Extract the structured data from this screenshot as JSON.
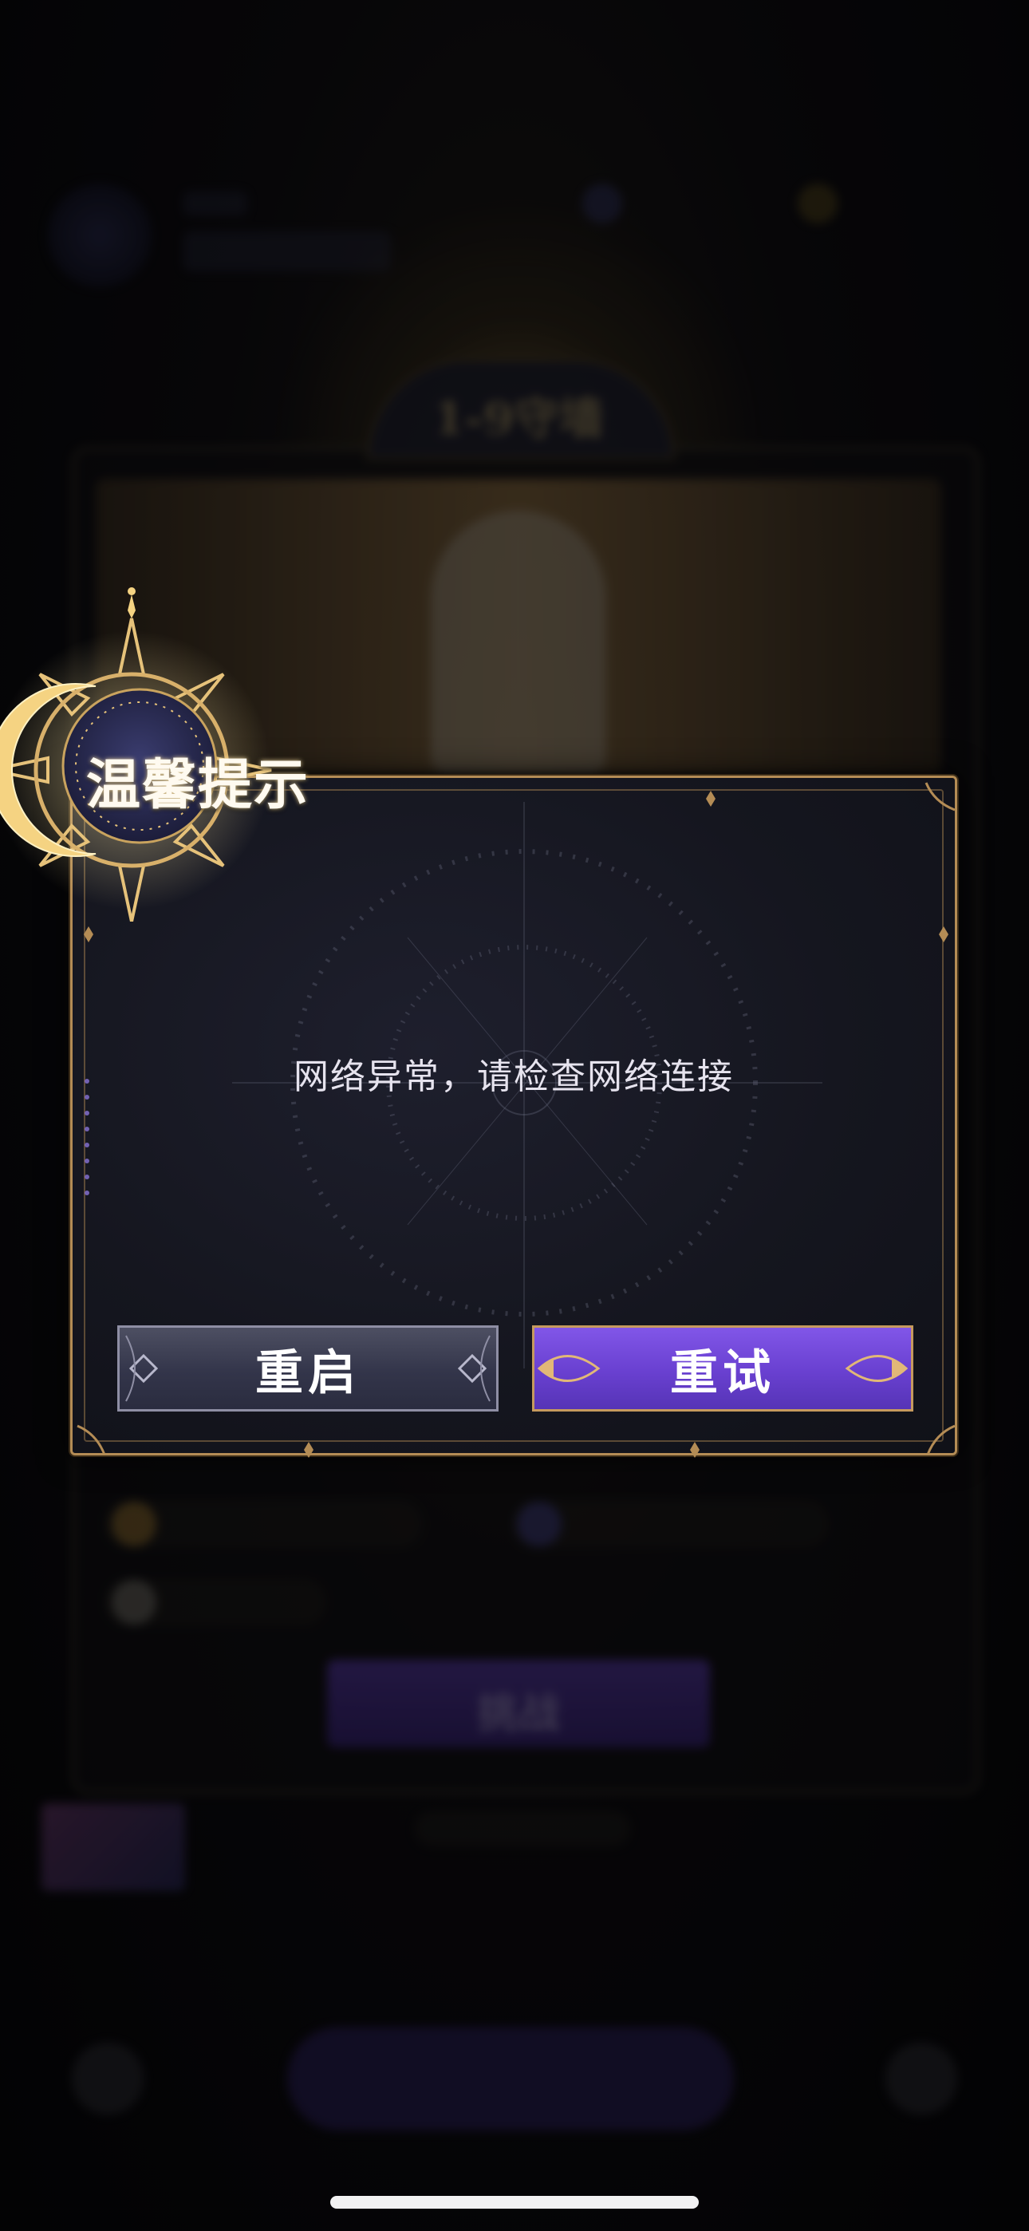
{
  "dialog": {
    "title": "温馨提示",
    "message": "网络异常，请检查网络连接",
    "buttons": {
      "restart_label": "重启",
      "retry_label": "重试"
    }
  },
  "background": {
    "banner_title": "1-9守墙",
    "challenge_label": "挑战"
  },
  "colors": {
    "gold_border": "#b48c55",
    "retry_purple": "#6940d0",
    "restart_gray": "#33354a",
    "dialog_bg": "#15161f"
  },
  "icons": {
    "title_emblem": "crescent-moon-sun-emblem-icon",
    "button_ornament": "flourish-icon"
  }
}
